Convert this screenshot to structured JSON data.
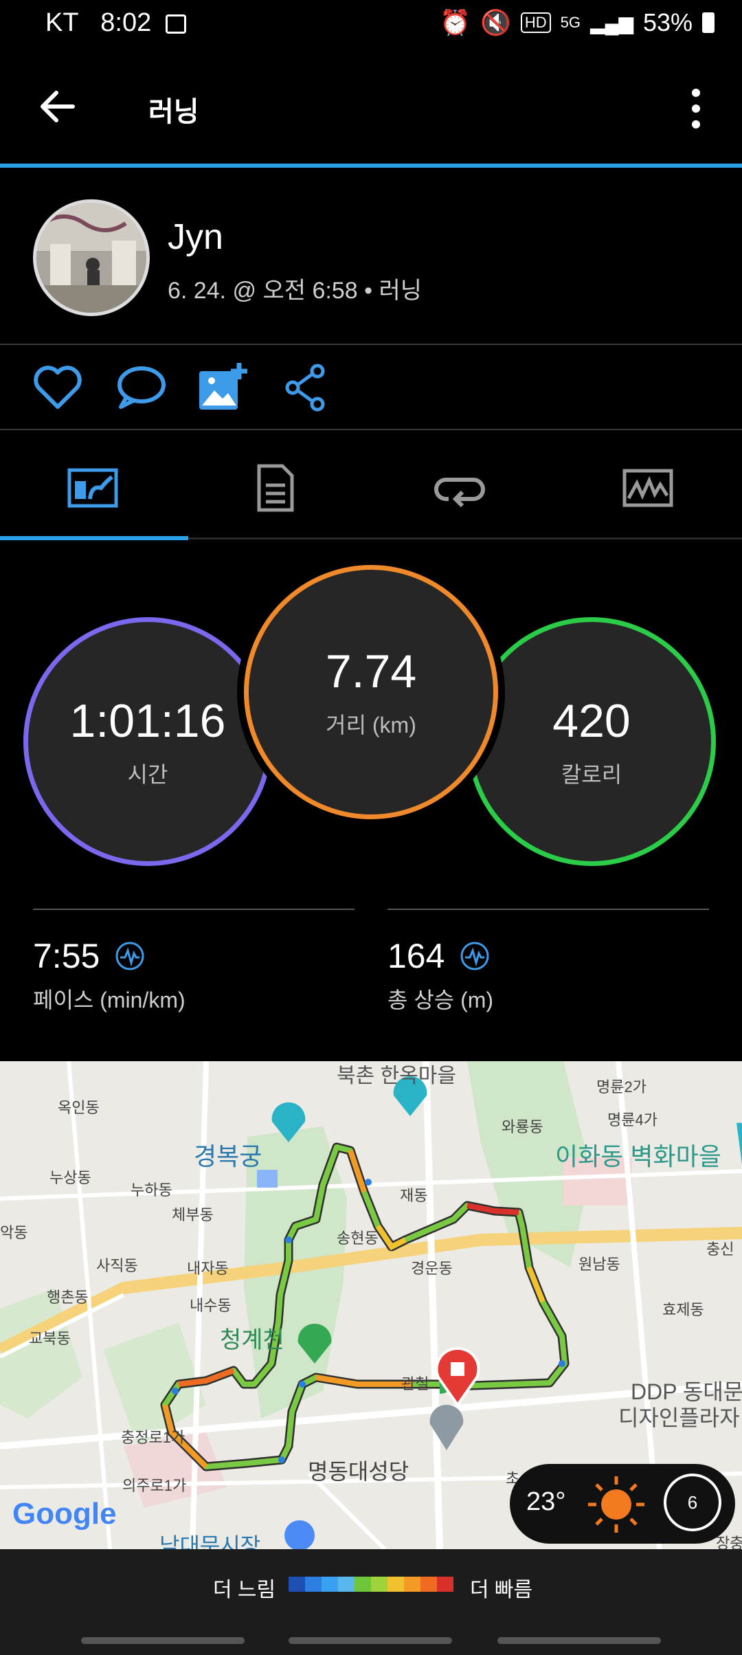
{
  "status_bar": {
    "carrier": "KT",
    "time": "8:02",
    "battery": "53%"
  },
  "app_bar": {
    "title": "러닝"
  },
  "profile": {
    "name": "Jyn",
    "subtitle": "6. 24. @ 오전 6:58 • 러닝"
  },
  "rings": {
    "time": {
      "value": "1:01:16",
      "label": "시간",
      "color": "#7b6cf0"
    },
    "distance": {
      "value": "7.74",
      "label": "거리 (km)",
      "color": "#f0892a"
    },
    "calories": {
      "value": "420",
      "label": "칼로리",
      "color": "#2fd04a"
    }
  },
  "stats": {
    "pace": {
      "value": "7:55",
      "label": "페이스 (min/km)"
    },
    "ascent": {
      "value": "164",
      "label": "총 상승 (m)"
    }
  },
  "map": {
    "labels": [
      "북촌 한옥마을",
      "옥인동",
      "명륜2가",
      "명륜4가",
      "와룡동",
      "경복궁",
      "누상동",
      "이화동 벽화마을",
      "누하동",
      "재동",
      "체부동",
      "송현동",
      "악동",
      "사직동",
      "내자동",
      "경운동",
      "원남동",
      "충신",
      "행촌동",
      "내수동",
      "효제동",
      "교북동",
      "청계천",
      "관철",
      "DDP 동대문",
      "디자인플라자",
      "충정로1가",
      "명동대성당",
      "의주로1가",
      "초",
      "남대문시장",
      "장충"
    ],
    "weather": {
      "temp": "23°",
      "wind": "6"
    }
  },
  "legend": {
    "slower": "더 느림",
    "faster": "더 빠름",
    "colors": [
      "#1d4fb0",
      "#2c7fe0",
      "#3aa0f0",
      "#59b7ec",
      "#6dc63a",
      "#9fd33b",
      "#f2c12e",
      "#f39a26",
      "#ee6b21",
      "#d9302a"
    ]
  }
}
